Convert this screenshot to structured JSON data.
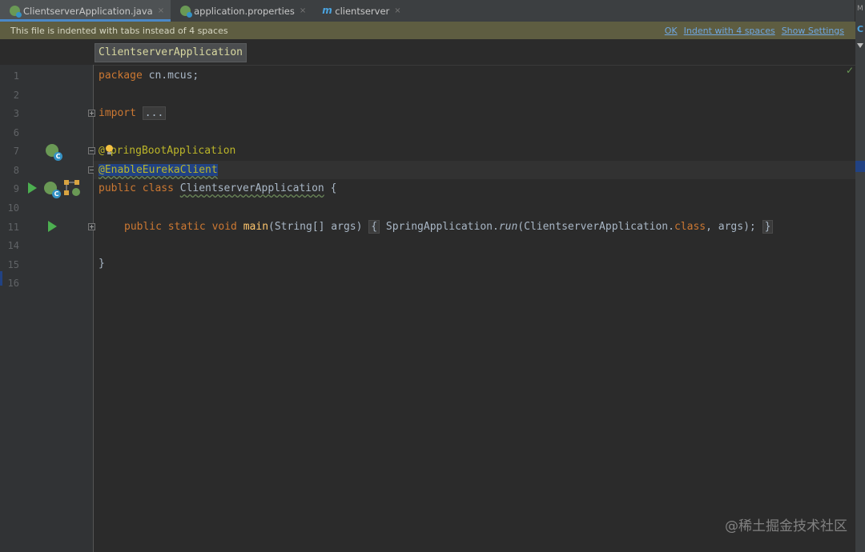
{
  "tabs": [
    {
      "label": "ClientserverApplication.java",
      "icon": "spring-class-icon",
      "active": true
    },
    {
      "label": "application.properties",
      "icon": "spring-properties-icon",
      "active": false
    },
    {
      "label": "clientserver",
      "icon": "maven-icon",
      "active": false
    }
  ],
  "tab_close_glyph": "×",
  "notification": {
    "message": "This file is indented with tabs instead of 4 spaces",
    "ok": "OK",
    "indent": "Indent with 4 spaces",
    "settings": "Show Settings"
  },
  "breadcrumb": "ClientserverApplication",
  "right_strip": {
    "m": "M",
    "c": "C"
  },
  "gutter": {
    "line_numbers": [
      "1",
      "2",
      "3",
      "6",
      "7",
      "8",
      "9",
      "10",
      "11",
      "14",
      "15",
      "16"
    ]
  },
  "code": {
    "l1_kw": "package",
    "l1_rest": " cn.mcus;",
    "l3_kw": "import",
    "l3_fold": "...",
    "l7_ann_a": "@",
    "l7_ann_b": "pringBootApplication",
    "l8_ann": "@EnableEurekaClient",
    "l9_kw": "public class ",
    "l9_name": "ClientserverApplication",
    "l9_rest": " {",
    "l11_kw": "public static void ",
    "l11_fn": "main",
    "l11_params": "(String[] args)",
    "l11_open": "{",
    "l11_call": "SpringApplication.",
    "l11_run": "run",
    "l11_arg_a": "(ClientserverApplication.",
    "l11_class": "class",
    "l11_arg_b": ", args);",
    "l11_close": "}",
    "l15": "}"
  },
  "check_glyph": "✓",
  "watermark": "@稀土掘金技术社区",
  "colors": {
    "keyword": "#cc7832",
    "annotation": "#bbb529",
    "selection": "#214283",
    "notification_bg": "#5e5d41"
  }
}
